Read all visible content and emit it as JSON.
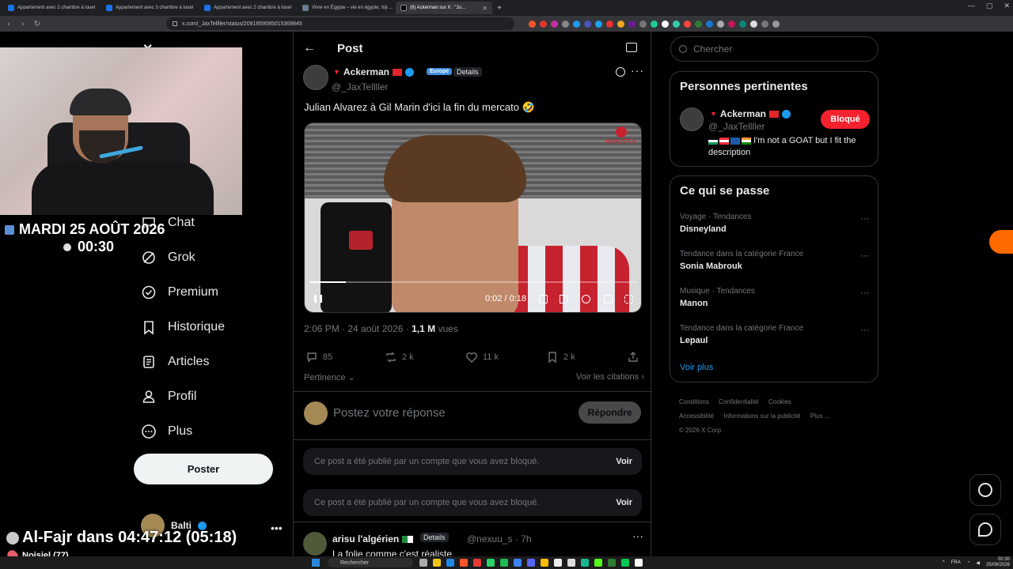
{
  "browser": {
    "tabs": [
      {
        "title": "Appartement avec 2 chambre à louer",
        "active": false,
        "favicon_color": "#1a73e8"
      },
      {
        "title": "Appartement avec 3 chambre à louer",
        "active": false,
        "favicon_color": "#1a73e8"
      },
      {
        "title": "Appartement avec 2 chambre à louer",
        "active": false,
        "favicon_color": "#1a73e8"
      },
      {
        "title": "Vivre en Égypte – vie en égypte, hijr…",
        "active": false,
        "favicon_color": "#6b7a8f"
      },
      {
        "title": "(6) Ackerman sur X : \"Ju…",
        "active": true,
        "favicon_color": "#000000"
      }
    ],
    "url": "x.com/_JaxTellller/status/2091859585015369845"
  },
  "overlay": {
    "date": "MARDI 25 AOÛT 2026",
    "time": "00:30",
    "prayer": "Al-Fajr dans 04:47:12 (05:18)",
    "location": "Noisiel (77)"
  },
  "sidebar": {
    "items": [
      {
        "label": "Chat",
        "icon": "chat-icon"
      },
      {
        "label": "Grok",
        "icon": "grok-icon"
      },
      {
        "label": "Premium",
        "icon": "premium-icon"
      },
      {
        "label": "Historique",
        "icon": "bookmark-icon"
      },
      {
        "label": "Articles",
        "icon": "articles-icon"
      },
      {
        "label": "Profil",
        "icon": "profile-icon"
      },
      {
        "label": "Plus",
        "icon": "more-icon"
      }
    ],
    "post_button": "Poster",
    "account_name": "Balti"
  },
  "post": {
    "header_title": "Post",
    "author_name": "Ackerman",
    "author_handle": "@_JaxTellller",
    "badge_region": "Europe",
    "badge_details": "Details",
    "text": "Julian Alvarez à Gil Marin d'ici la fin du mercato 🤣",
    "video": {
      "timecode": "0:02 / 0:18",
      "progress": 0.11,
      "brand": "OUHUSTLE"
    },
    "time": "2:06 PM · 24 août 2026 · ",
    "views_count": "1,1 M",
    "views_label": " vues",
    "stats": {
      "replies": "85",
      "reposts": "2 k",
      "likes": "11 k",
      "bookmarks": "2 k"
    },
    "sort_label": "Pertinence",
    "quotes_label": "Voir les citations"
  },
  "reply_box": {
    "placeholder": "Postez votre réponse",
    "button": "Répondre"
  },
  "blocked_notices": [
    {
      "text": "Ce post a été publié par un compte que vous avez bloqué.",
      "action": "Voir"
    },
    {
      "text": "Ce post a été publié par un compte que vous avez bloqué.",
      "action": "Voir"
    }
  ],
  "reply": {
    "name": "arisu l'algérien",
    "details": "Details",
    "handle_time": "@nexuu_s · 7h",
    "text": "La folie comme c'est réaliste"
  },
  "search": {
    "placeholder": "Chercher"
  },
  "relevant": {
    "title": "Personnes pertinentes",
    "name": "Ackerman",
    "handle": "@_JaxTellller",
    "button": "Bloqué",
    "bio": "I'm not a GOAT but I fit the description"
  },
  "trending": {
    "title": "Ce qui se passe",
    "items": [
      {
        "category": "Voyage · Tendances",
        "title": "Disneyland"
      },
      {
        "category": "Tendance dans la catégorie France",
        "title": "Sonia Mabrouk"
      },
      {
        "category": "Musique · Tendances",
        "title": "Manon"
      },
      {
        "category": "Tendance dans la catégorie France",
        "title": "Lepaul"
      }
    ],
    "see_more": "Voir plus"
  },
  "footer": {
    "links": [
      "Conditions",
      "Confidentialité",
      "Cookies",
      "Accessibilité",
      "Informations sur la publicité",
      "Plus ..."
    ],
    "copyright": "© 2026 X Corp."
  },
  "taskbar": {
    "search": "Rechercher",
    "lang": "FRA",
    "clock_time": "00:30",
    "clock_date": "25/08/2026"
  },
  "colors": {
    "accent": "#1d9bf0",
    "danger": "#f4212e",
    "bg": "#000000"
  }
}
